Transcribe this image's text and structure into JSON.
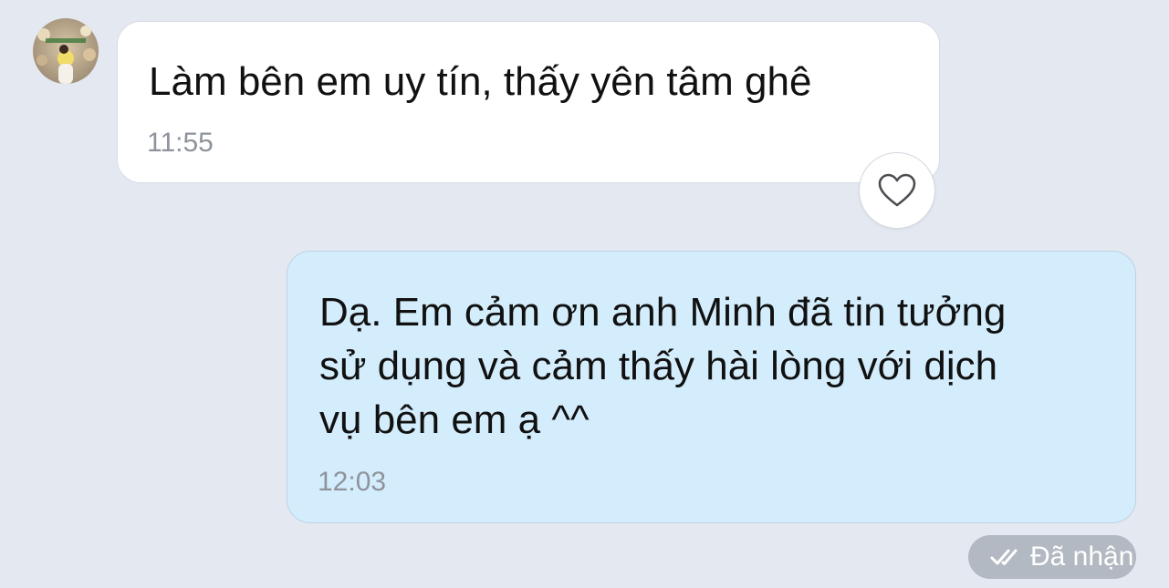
{
  "messages": {
    "incoming": {
      "text": "Làm bên em uy tín, thấy yên tâm ghê",
      "time": "11:55"
    },
    "outgoing": {
      "text": "Dạ. Em cảm ơn anh Minh đã tin tưởng\nsử dụng và cảm thấy hài lòng với dịch\nvụ bên em ạ ^^",
      "time": "12:03",
      "status": "Đã nhận"
    }
  },
  "icons": {
    "reaction": "heart-icon",
    "status": "double-check-icon",
    "avatar": "avatar"
  },
  "colors": {
    "background": "#e4e8f1",
    "incoming_bubble": "#ffffff",
    "outgoing_bubble": "#d4edfc",
    "status_pill": "#b3b9c2"
  }
}
